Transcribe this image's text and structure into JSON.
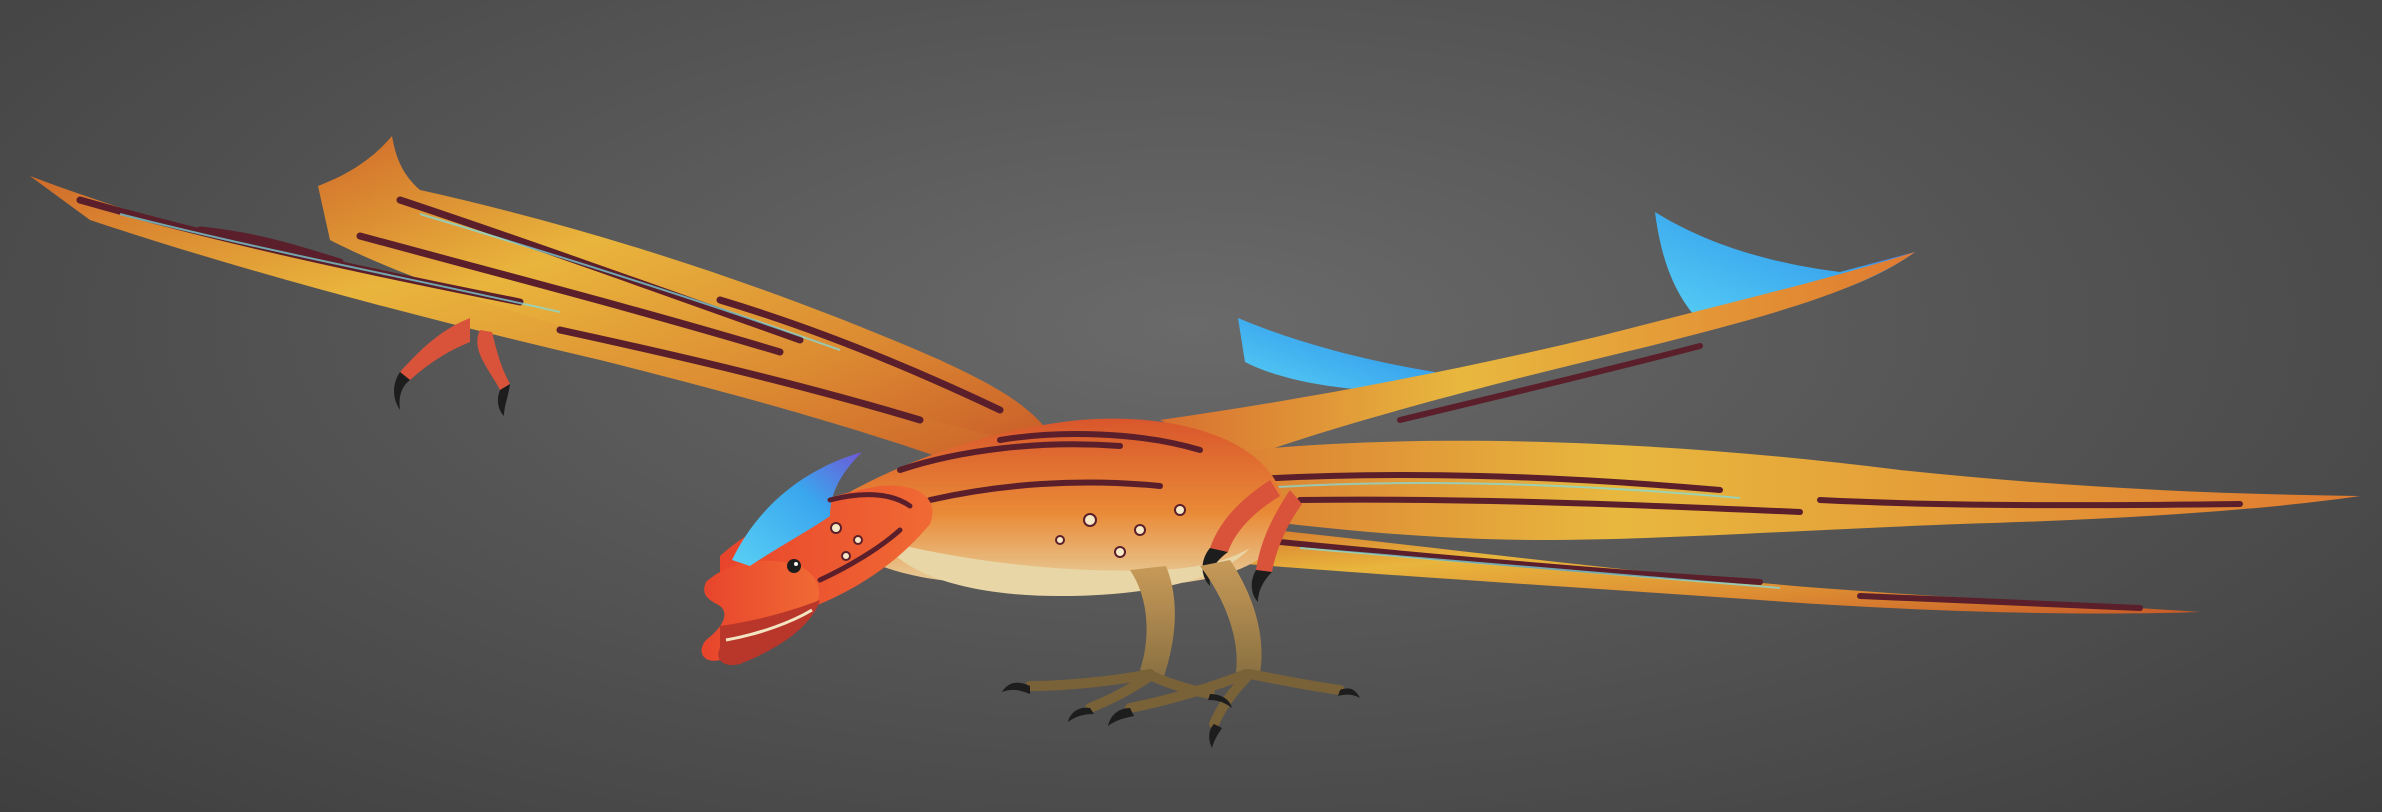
{
  "scene": {
    "subject_icon": "flying-creature-render",
    "colors": {
      "background": "#555555",
      "wing_yellow": "#e6b23a",
      "wing_orange": "#e0792c",
      "stripe_dark": "#5a1f2a",
      "crest_blue": "#3fc8f2",
      "crest_violet": "#6a5ad8",
      "head_red": "#e0452e",
      "belly_cream": "#e8d6a6",
      "leg_tan": "#b89a5a",
      "claw_black": "#1d1d1d"
    }
  }
}
